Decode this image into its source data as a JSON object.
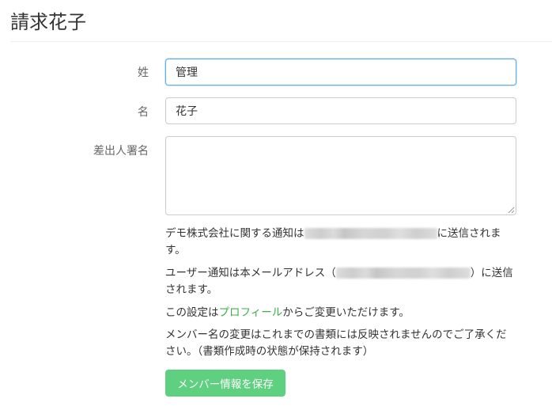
{
  "page": {
    "title": "請求花子"
  },
  "form": {
    "last_name": {
      "label": "姓",
      "value": "管理"
    },
    "first_name": {
      "label": "名",
      "value": "花子"
    },
    "sender_name": {
      "label": "差出人署名",
      "value": ""
    },
    "help": {
      "notice_company_prefix": "デモ株式会社に関する通知は",
      "notice_company_suffix": "に送信されます。",
      "notice_user_prefix": "ユーザー通知は本メールアドレス（",
      "notice_user_suffix": "）に送信されます。",
      "settings_prefix": "この設定は",
      "settings_link": "プロフィール",
      "settings_suffix": "からご変更いただけます。",
      "name_change_note": "メンバー名の変更はこれまでの書類には反映されませんのでご了承ください。（書類作成時の状態が保持されます）"
    },
    "save_label": "メンバー情報を保存"
  },
  "colors": {
    "accent_green": "#5fcf80",
    "link_green": "#3fae49",
    "focus_blue": "#66afe9"
  }
}
